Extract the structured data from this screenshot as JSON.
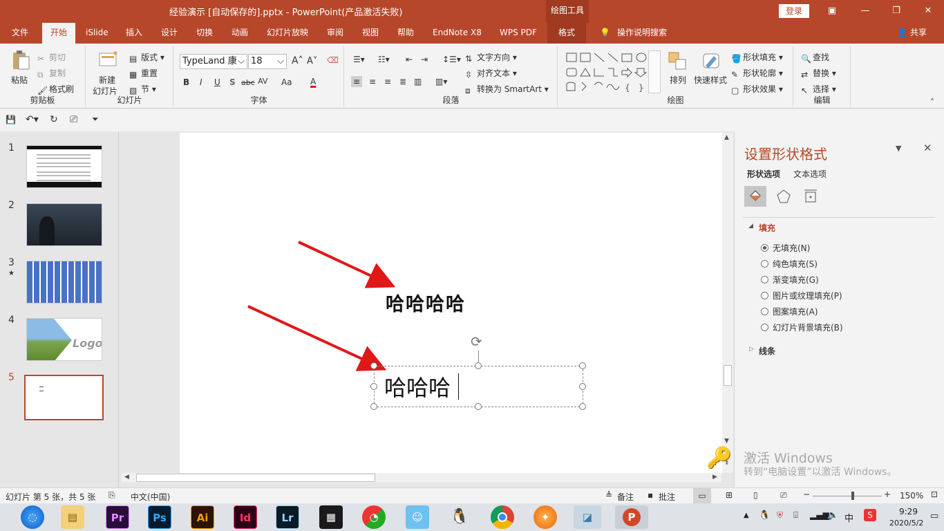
{
  "window": {
    "title": "经验演示 [自动保存的].pptx  -  PowerPoint(产品激活失败)",
    "context_tool": "绘图工具",
    "login_label": "登录"
  },
  "tabs": [
    "文件",
    "开始",
    "iSlide",
    "插入",
    "设计",
    "切换",
    "动画",
    "幻灯片放映",
    "审阅",
    "视图",
    "帮助",
    "EndNote X8",
    "WPS PDF",
    "格式"
  ],
  "active_tab": "开始",
  "tell_me": "操作说明搜索",
  "share": "共享",
  "ribbon": {
    "clipboard": {
      "paste": "粘贴",
      "cut": "剪切",
      "copy": "复制",
      "format_painter": "格式刷",
      "label": "剪贴板"
    },
    "slides": {
      "new_slide_line1": "新建",
      "new_slide_line2": "幻灯片",
      "layout": "版式",
      "reset": "重置",
      "section": "节",
      "label": "幻灯片"
    },
    "font": {
      "font_name": "TypeLand 康",
      "font_size": "18",
      "label": "字体",
      "bold": "B",
      "italic": "I",
      "underline": "U",
      "shadow": "S",
      "strike": "abc",
      "spacing": "AV",
      "case": "Aa",
      "color": "A"
    },
    "paragraph": {
      "text_direction": "文字方向",
      "align_text": "对齐文本",
      "smartart": "转换为 SmartArt",
      "label": "段落"
    },
    "drawing": {
      "arrange": "排列",
      "quick_styles": "快速样式",
      "shape_fill": "形状填充",
      "shape_outline": "形状轮廓",
      "shape_effects": "形状效果",
      "label": "绘图"
    },
    "editing": {
      "find": "查找",
      "replace": "替换",
      "select": "选择",
      "label": "编辑"
    }
  },
  "slides": [
    {
      "number": "1"
    },
    {
      "number": "2"
    },
    {
      "number": "3",
      "star": "★"
    },
    {
      "number": "4",
      "logo_text": "Logo"
    },
    {
      "number": "5",
      "selected": true
    }
  ],
  "canvas": {
    "text1": "哈哈哈哈",
    "text2": "哈哈哈"
  },
  "format_pane": {
    "title": "设置形状格式",
    "tab_shape": "形状选项",
    "tab_text": "文本选项",
    "fill_section": "填充",
    "fill_options": [
      "无填充(N)",
      "纯色填充(S)",
      "渐变填充(G)",
      "图片或纹理填充(P)",
      "图案填充(A)",
      "幻灯片背景填充(B)"
    ],
    "selected_fill": 0,
    "line_section": "线条"
  },
  "watermark": {
    "line1": "激活 Windows",
    "line2": "转到“电脑设置”以激活 Windows。"
  },
  "status": {
    "slide_info": "幻灯片 第 5 张，共 5 张",
    "language": "中文(中国)",
    "notes": "备注",
    "comments": "批注",
    "zoom": "150%"
  },
  "taskbar": {
    "apps": [
      "Pr",
      "Ps",
      "Ai",
      "Id",
      "Lr"
    ],
    "time": "9:29",
    "date": "2020/5/2",
    "ime": "中"
  },
  "colors": {
    "accent": "#b7472a",
    "arrow": "#e01818"
  }
}
